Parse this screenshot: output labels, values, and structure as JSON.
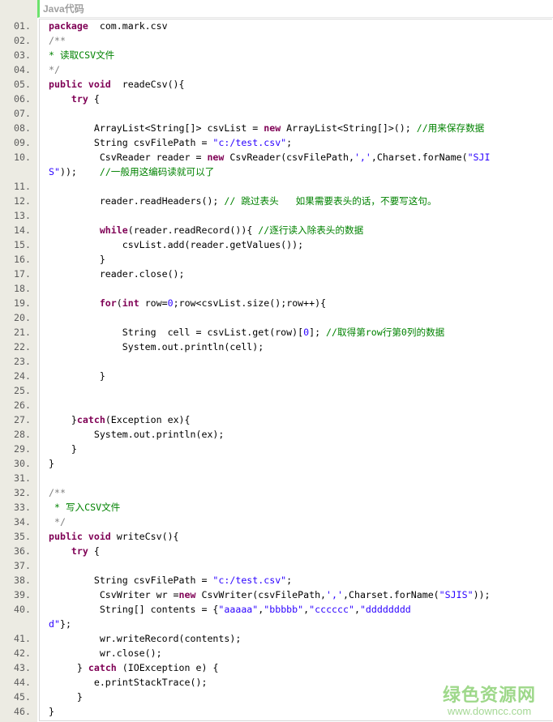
{
  "header": {
    "title": "Java代码"
  },
  "watermark": {
    "name": "绿色资源网",
    "url": "www.downcc.com"
  },
  "lines": [
    {
      "n": "01.",
      "s": [
        [
          "kw",
          "package"
        ],
        [
          "",
          "  com.mark.csv"
        ]
      ]
    },
    {
      "n": "02.",
      "s": [
        [
          "cmg",
          "/**"
        ]
      ]
    },
    {
      "n": "03.",
      "s": [
        [
          "cm",
          "* 读取CSV文件"
        ]
      ]
    },
    {
      "n": "04.",
      "s": [
        [
          "cmg",
          "*/"
        ]
      ]
    },
    {
      "n": "05.",
      "s": [
        [
          "kw",
          "public void"
        ],
        [
          "",
          "  readeCsv(){"
        ]
      ]
    },
    {
      "n": "06.",
      "s": [
        [
          "",
          "    "
        ],
        [
          "kw",
          "try"
        ],
        [
          "",
          " {"
        ]
      ]
    },
    {
      "n": "07.",
      "s": []
    },
    {
      "n": "08.",
      "s": [
        [
          "",
          "        ArrayList<String[]> csvList = "
        ],
        [
          "kw",
          "new"
        ],
        [
          "",
          " ArrayList<String[]>(); "
        ],
        [
          "cm",
          "//用来保存数据"
        ]
      ]
    },
    {
      "n": "09.",
      "s": [
        [
          "",
          "        String csvFilePath = "
        ],
        [
          "str",
          "\"c:/test.csv\""
        ],
        [
          "",
          ";"
        ]
      ]
    },
    {
      "n": "10.",
      "s": [
        [
          "",
          "         CsvReader reader = "
        ],
        [
          "kw",
          "new"
        ],
        [
          "",
          " CsvReader(csvFilePath,"
        ],
        [
          "str",
          "','"
        ],
        [
          "",
          ",Charset.forName("
        ],
        [
          "str",
          "\"SJI"
        ]
      ]
    },
    {
      "n": "",
      "s": [
        [
          "str",
          "S\""
        ],
        [
          "",
          "));    "
        ],
        [
          "cm",
          "//一般用这编码读就可以了"
        ]
      ]
    },
    {
      "n": "11.",
      "s": []
    },
    {
      "n": "12.",
      "s": [
        [
          "",
          "         reader.readHeaders(); "
        ],
        [
          "cm",
          "// 跳过表头   如果需要表头的话，不要写这句。"
        ]
      ]
    },
    {
      "n": "13.",
      "s": []
    },
    {
      "n": "14.",
      "s": [
        [
          "",
          "         "
        ],
        [
          "kw",
          "while"
        ],
        [
          "",
          "(reader.readRecord()){ "
        ],
        [
          "cm",
          "//逐行读入除表头的数据"
        ]
      ]
    },
    {
      "n": "15.",
      "s": [
        [
          "",
          "             csvList.add(reader.getValues());"
        ]
      ]
    },
    {
      "n": "16.",
      "s": [
        [
          "",
          "         }"
        ]
      ]
    },
    {
      "n": "17.",
      "s": [
        [
          "",
          "         reader.close();"
        ]
      ]
    },
    {
      "n": "18.",
      "s": []
    },
    {
      "n": "19.",
      "s": [
        [
          "",
          "         "
        ],
        [
          "kw",
          "for"
        ],
        [
          "",
          "("
        ],
        [
          "kw",
          "int"
        ],
        [
          "",
          " row="
        ],
        [
          "str",
          "0"
        ],
        [
          "",
          ";row<csvList.size();row++){"
        ]
      ]
    },
    {
      "n": "20.",
      "s": []
    },
    {
      "n": "21.",
      "s": [
        [
          "",
          "             String  cell = csvList.get(row)["
        ],
        [
          "str",
          "0"
        ],
        [
          "",
          "]; "
        ],
        [
          "cm",
          "//取得第row行第0列的数据"
        ]
      ]
    },
    {
      "n": "22.",
      "s": [
        [
          "",
          "             System.out.println(cell);"
        ]
      ]
    },
    {
      "n": "23.",
      "s": []
    },
    {
      "n": "24.",
      "s": [
        [
          "",
          "         }"
        ]
      ]
    },
    {
      "n": "25.",
      "s": []
    },
    {
      "n": "26.",
      "s": []
    },
    {
      "n": "27.",
      "s": [
        [
          "",
          "    }"
        ],
        [
          "kw",
          "catch"
        ],
        [
          "",
          "(Exception ex){"
        ]
      ]
    },
    {
      "n": "28.",
      "s": [
        [
          "",
          "        System.out.println(ex);"
        ]
      ]
    },
    {
      "n": "29.",
      "s": [
        [
          "",
          "    }"
        ]
      ]
    },
    {
      "n": "30.",
      "s": [
        [
          "",
          "}"
        ]
      ]
    },
    {
      "n": "31.",
      "s": []
    },
    {
      "n": "32.",
      "s": [
        [
          "cmg",
          "/**"
        ]
      ]
    },
    {
      "n": "33.",
      "s": [
        [
          "cm",
          " * 写入CSV文件"
        ]
      ]
    },
    {
      "n": "34.",
      "s": [
        [
          "cmg",
          " */"
        ]
      ]
    },
    {
      "n": "35.",
      "s": [
        [
          "kw",
          "public void"
        ],
        [
          "",
          " writeCsv(){"
        ]
      ]
    },
    {
      "n": "36.",
      "s": [
        [
          "",
          "    "
        ],
        [
          "kw",
          "try"
        ],
        [
          "",
          " {"
        ]
      ]
    },
    {
      "n": "37.",
      "s": []
    },
    {
      "n": "38.",
      "s": [
        [
          "",
          "        String csvFilePath = "
        ],
        [
          "str",
          "\"c:/test.csv\""
        ],
        [
          "",
          ";"
        ]
      ]
    },
    {
      "n": "39.",
      "s": [
        [
          "",
          "         CsvWriter wr ="
        ],
        [
          "kw",
          "new"
        ],
        [
          "",
          " CsvWriter(csvFilePath,"
        ],
        [
          "str",
          "','"
        ],
        [
          "",
          ",Charset.forName("
        ],
        [
          "str",
          "\"SJIS\""
        ],
        [
          "",
          "));"
        ]
      ]
    },
    {
      "n": "40.",
      "s": [
        [
          "",
          "         String[] contents = {"
        ],
        [
          "str",
          "\"aaaaa\""
        ],
        [
          "",
          ","
        ],
        [
          "str",
          "\"bbbbb\""
        ],
        [
          "",
          ","
        ],
        [
          "str",
          "\"cccccc\""
        ],
        [
          "",
          ","
        ],
        [
          "str",
          "\"dddddddd"
        ]
      ]
    },
    {
      "n": "",
      "s": [
        [
          "str",
          "d\""
        ],
        [
          "",
          "};"
        ]
      ]
    },
    {
      "n": "41.",
      "s": [
        [
          "",
          "         wr.writeRecord(contents);"
        ]
      ]
    },
    {
      "n": "42.",
      "s": [
        [
          "",
          "         wr.close();"
        ]
      ]
    },
    {
      "n": "43.",
      "s": [
        [
          "",
          "     } "
        ],
        [
          "kw",
          "catch"
        ],
        [
          "",
          " (IOException e) {"
        ]
      ]
    },
    {
      "n": "44.",
      "s": [
        [
          "",
          "        e.printStackTrace();"
        ]
      ]
    },
    {
      "n": "45.",
      "s": [
        [
          "",
          "     }"
        ]
      ]
    },
    {
      "n": "46.",
      "s": [
        [
          "",
          "}"
        ]
      ]
    }
  ]
}
